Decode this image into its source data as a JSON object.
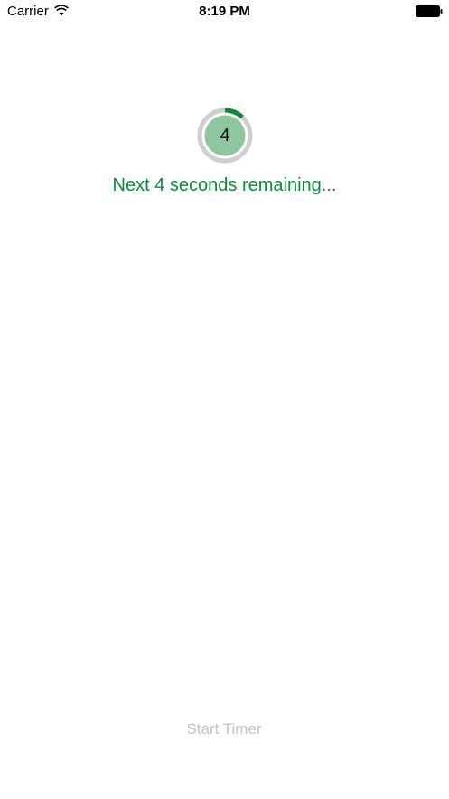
{
  "status_bar": {
    "carrier": "Carrier",
    "time": "8:19 PM",
    "wifi_icon": "wifi-icon",
    "battery_icon": "battery-icon"
  },
  "timer": {
    "count": "4",
    "progress_fraction": 0.12,
    "track_color": "#cfcfcf",
    "progress_color": "#0e8a3a",
    "fill_color": "#8fc6a0"
  },
  "message": "Next 4 seconds remaining...",
  "start_button": {
    "label": "Start Timer",
    "color": "#c4c4c4"
  }
}
